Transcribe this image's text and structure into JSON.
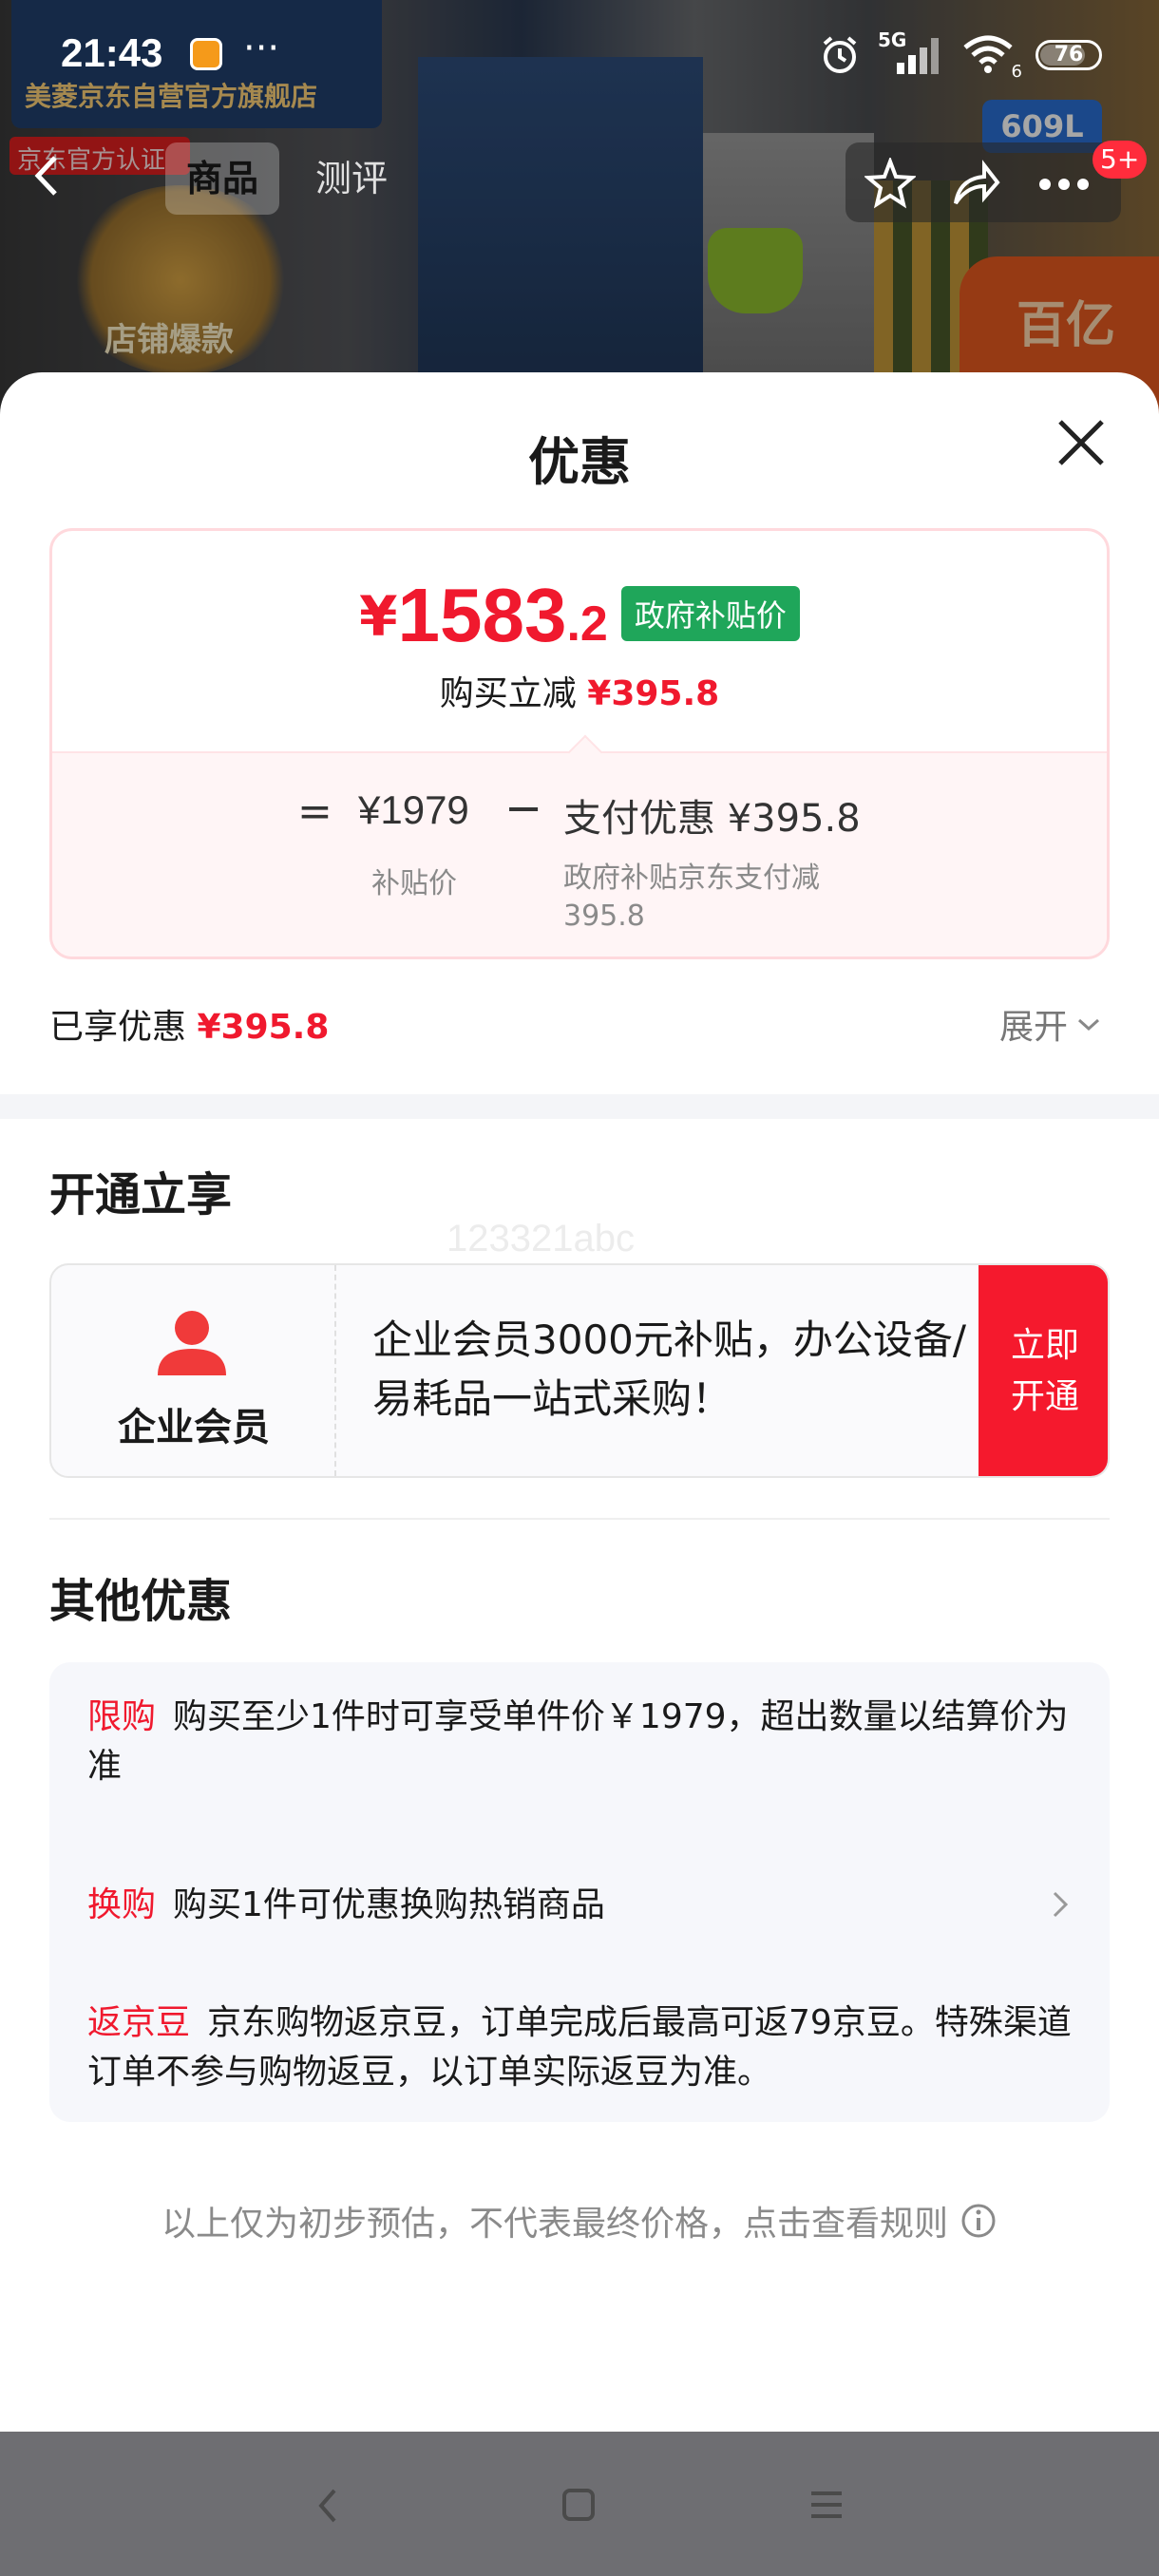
{
  "status_bar": {
    "time": "21:43",
    "dots": "···",
    "network": "5G",
    "wifi_label": "6",
    "battery": "76",
    "battery_level": 0.76
  },
  "background": {
    "brand_text": "美菱京东自营官方旗舰店",
    "official_tag": "京东官方认证",
    "trophy_label": "店铺爆款",
    "size_tag": "609L",
    "promo_text": "百亿"
  },
  "nav": {
    "tabs": [
      {
        "label": "商品",
        "active": true
      },
      {
        "label": "测评",
        "active": false
      }
    ],
    "cart_badge": "5+"
  },
  "sheet": {
    "title": "优惠",
    "price": {
      "currency": "¥",
      "integer": "1583",
      "decimal": ".2",
      "gov_tag": "政府补贴价",
      "reduce_label": "购买立减",
      "reduce_value": "¥395.8"
    },
    "breakdown": {
      "equals": "=",
      "base_price": "¥1979",
      "minus": "−",
      "pay_discount": "支付优惠 ¥395.8",
      "base_label": "补贴价",
      "pay_desc": "政府补贴京东支付减395.8"
    },
    "enjoyed": {
      "label": "已享优惠",
      "value": "¥395.8"
    },
    "expand_label": "展开",
    "open_section": {
      "title": "开通立享",
      "watermark": "123321abc",
      "member_name": "企业会员",
      "member_desc": "企业会员3000元补贴，办公设备/易耗品一站式采购！",
      "button": "立即开通"
    },
    "other_section": {
      "title": "其他优惠",
      "offers": [
        {
          "tag": "限购",
          "text": "购买至少1件时可享受单件价￥1979，超出数量以结算价为准"
        },
        {
          "tag": "换购",
          "text": "购买1件可优惠换购热销商品"
        },
        {
          "tag": "返京豆",
          "text": "京东购物返京豆，订单完成后最高可返79京豆。特殊渠道订单不参与购物返豆，以订单实际返豆为准。"
        }
      ]
    },
    "footer_note": "以上仅为初步预估，不代表最终价格，点击查看规则"
  },
  "colors": {
    "accent_red": "#f0192e",
    "gov_green": "#1fa65a"
  }
}
